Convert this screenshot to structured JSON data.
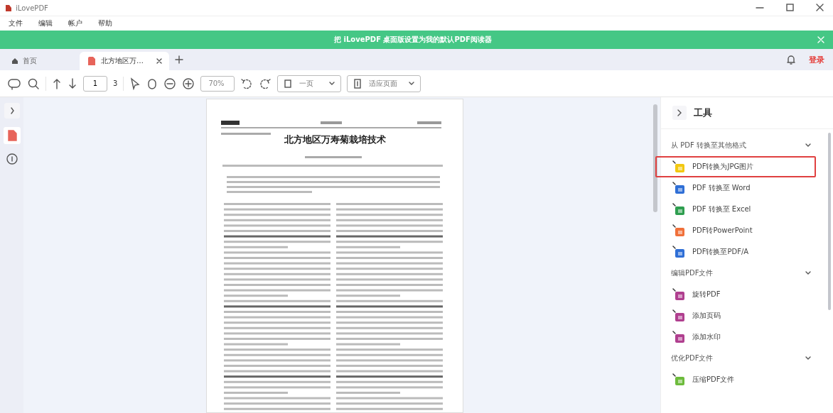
{
  "window": {
    "title": "iLovePDF"
  },
  "menu": [
    "文件",
    "编辑",
    "帐户",
    "帮助"
  ],
  "banner": {
    "text": "把 iLovePDF 桌面版设置为我的默认PDF阅读器"
  },
  "tabs": [
    {
      "kind": "home",
      "label": "首页",
      "selected": false
    },
    {
      "kind": "file",
      "label": "北方地区万…",
      "selected": true
    }
  ],
  "account": {
    "login": "登录"
  },
  "toolbar": {
    "page": "1",
    "page_count": "3",
    "zoom": "70%",
    "view_mode": "一页",
    "fit_mode": "适应页面"
  },
  "document": {
    "title": "北方地区万寿菊栽培技术"
  },
  "tools": {
    "title": "工具",
    "groups": [
      {
        "title": "从 PDF 转换至其他格式",
        "expanded": true,
        "items": [
          {
            "label": "PDF转换为JPG图片",
            "color": "#f2c811",
            "highlighted": true
          },
          {
            "label": "PDF 转换至 Word",
            "color": "#2f6fd6",
            "highlighted": false
          },
          {
            "label": "PDF 转换至 Excel",
            "color": "#2e9e4f",
            "highlighted": false
          },
          {
            "label": "PDF转PowerPoint",
            "color": "#f0703a",
            "highlighted": false
          },
          {
            "label": "PDF转换至PDF/A",
            "color": "#2f6fd6",
            "highlighted": false
          }
        ]
      },
      {
        "title": "编辑PDF文件",
        "expanded": true,
        "items": [
          {
            "label": "旋转PDF",
            "color": "#b03f8f",
            "highlighted": false
          },
          {
            "label": "添加页码",
            "color": "#b03f8f",
            "highlighted": false
          },
          {
            "label": "添加水印",
            "color": "#b03f8f",
            "highlighted": false
          }
        ]
      },
      {
        "title": "优化PDF文件",
        "expanded": true,
        "items": [
          {
            "label": "压缩PDF文件",
            "color": "#6dbb3c",
            "highlighted": false
          }
        ]
      }
    ]
  }
}
